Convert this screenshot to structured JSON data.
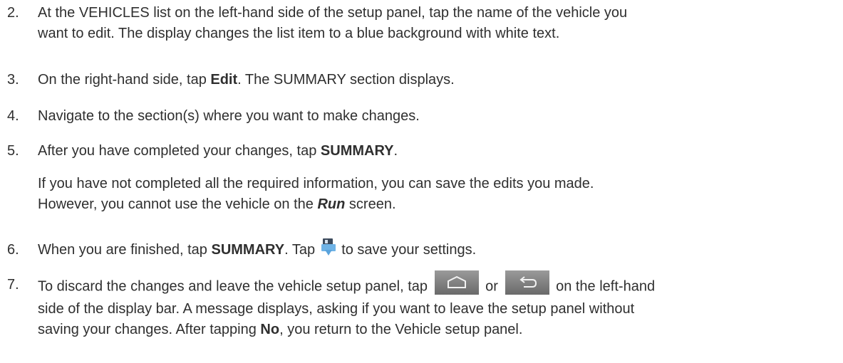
{
  "steps": [
    {
      "num": "2.",
      "text_a": "At the VEHICLES list on the left-hand side of the setup panel, tap the name of the vehicle you",
      "text_b": "want to edit. The display changes the list item to a blue background with white text."
    },
    {
      "num": "3.",
      "pre": "On the right-hand side, tap ",
      "bold": "Edit",
      "post": ". The SUMMARY section displays."
    },
    {
      "num": "4.",
      "text": "Navigate to the section(s) where you want to make changes."
    },
    {
      "num": "5.",
      "pre": "After you have completed your changes, tap ",
      "bold": "SUMMARY",
      "post": ".",
      "note_a": "If you have not completed all the required information, you can save the edits you made.",
      "note_b_pre": "However, you cannot use the vehicle on the ",
      "note_b_bold": "Run",
      "note_b_post": " screen."
    },
    {
      "num": "6.",
      "pre": "When you are finished, tap ",
      "bold": "SUMMARY",
      "mid": ". Tap ",
      "post": " to save your settings."
    },
    {
      "num": "7.",
      "pre": "To discard the changes and leave the vehicle setup panel, tap ",
      "or": " or ",
      "post": " on the left-hand",
      "line2": "side of the display bar. A message displays, asking if you want to leave the setup panel without",
      "line3_pre": "saving your changes. After tapping ",
      "line3_bold": "No",
      "line3_post": ", you return to the Vehicle setup panel."
    }
  ],
  "icons": {
    "save": "save-settings-icon",
    "home": "home-button-icon",
    "back": "back-button-icon"
  }
}
